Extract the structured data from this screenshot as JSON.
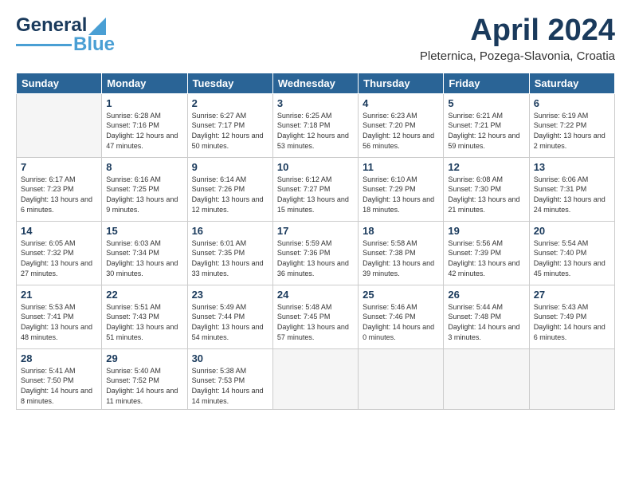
{
  "header": {
    "logo": {
      "line1": "General",
      "line2": "Blue"
    },
    "title": "April 2024",
    "location": "Pleternica, Pozega-Slavonia, Croatia"
  },
  "calendar": {
    "days_of_week": [
      "Sunday",
      "Monday",
      "Tuesday",
      "Wednesday",
      "Thursday",
      "Friday",
      "Saturday"
    ],
    "weeks": [
      [
        {
          "day": "",
          "sunrise": "",
          "sunset": "",
          "daylight": ""
        },
        {
          "day": "1",
          "sunrise": "Sunrise: 6:28 AM",
          "sunset": "Sunset: 7:16 PM",
          "daylight": "Daylight: 12 hours and 47 minutes."
        },
        {
          "day": "2",
          "sunrise": "Sunrise: 6:27 AM",
          "sunset": "Sunset: 7:17 PM",
          "daylight": "Daylight: 12 hours and 50 minutes."
        },
        {
          "day": "3",
          "sunrise": "Sunrise: 6:25 AM",
          "sunset": "Sunset: 7:18 PM",
          "daylight": "Daylight: 12 hours and 53 minutes."
        },
        {
          "day": "4",
          "sunrise": "Sunrise: 6:23 AM",
          "sunset": "Sunset: 7:20 PM",
          "daylight": "Daylight: 12 hours and 56 minutes."
        },
        {
          "day": "5",
          "sunrise": "Sunrise: 6:21 AM",
          "sunset": "Sunset: 7:21 PM",
          "daylight": "Daylight: 12 hours and 59 minutes."
        },
        {
          "day": "6",
          "sunrise": "Sunrise: 6:19 AM",
          "sunset": "Sunset: 7:22 PM",
          "daylight": "Daylight: 13 hours and 2 minutes."
        }
      ],
      [
        {
          "day": "7",
          "sunrise": "Sunrise: 6:17 AM",
          "sunset": "Sunset: 7:23 PM",
          "daylight": "Daylight: 13 hours and 6 minutes."
        },
        {
          "day": "8",
          "sunrise": "Sunrise: 6:16 AM",
          "sunset": "Sunset: 7:25 PM",
          "daylight": "Daylight: 13 hours and 9 minutes."
        },
        {
          "day": "9",
          "sunrise": "Sunrise: 6:14 AM",
          "sunset": "Sunset: 7:26 PM",
          "daylight": "Daylight: 13 hours and 12 minutes."
        },
        {
          "day": "10",
          "sunrise": "Sunrise: 6:12 AM",
          "sunset": "Sunset: 7:27 PM",
          "daylight": "Daylight: 13 hours and 15 minutes."
        },
        {
          "day": "11",
          "sunrise": "Sunrise: 6:10 AM",
          "sunset": "Sunset: 7:29 PM",
          "daylight": "Daylight: 13 hours and 18 minutes."
        },
        {
          "day": "12",
          "sunrise": "Sunrise: 6:08 AM",
          "sunset": "Sunset: 7:30 PM",
          "daylight": "Daylight: 13 hours and 21 minutes."
        },
        {
          "day": "13",
          "sunrise": "Sunrise: 6:06 AM",
          "sunset": "Sunset: 7:31 PM",
          "daylight": "Daylight: 13 hours and 24 minutes."
        }
      ],
      [
        {
          "day": "14",
          "sunrise": "Sunrise: 6:05 AM",
          "sunset": "Sunset: 7:32 PM",
          "daylight": "Daylight: 13 hours and 27 minutes."
        },
        {
          "day": "15",
          "sunrise": "Sunrise: 6:03 AM",
          "sunset": "Sunset: 7:34 PM",
          "daylight": "Daylight: 13 hours and 30 minutes."
        },
        {
          "day": "16",
          "sunrise": "Sunrise: 6:01 AM",
          "sunset": "Sunset: 7:35 PM",
          "daylight": "Daylight: 13 hours and 33 minutes."
        },
        {
          "day": "17",
          "sunrise": "Sunrise: 5:59 AM",
          "sunset": "Sunset: 7:36 PM",
          "daylight": "Daylight: 13 hours and 36 minutes."
        },
        {
          "day": "18",
          "sunrise": "Sunrise: 5:58 AM",
          "sunset": "Sunset: 7:38 PM",
          "daylight": "Daylight: 13 hours and 39 minutes."
        },
        {
          "day": "19",
          "sunrise": "Sunrise: 5:56 AM",
          "sunset": "Sunset: 7:39 PM",
          "daylight": "Daylight: 13 hours and 42 minutes."
        },
        {
          "day": "20",
          "sunrise": "Sunrise: 5:54 AM",
          "sunset": "Sunset: 7:40 PM",
          "daylight": "Daylight: 13 hours and 45 minutes."
        }
      ],
      [
        {
          "day": "21",
          "sunrise": "Sunrise: 5:53 AM",
          "sunset": "Sunset: 7:41 PM",
          "daylight": "Daylight: 13 hours and 48 minutes."
        },
        {
          "day": "22",
          "sunrise": "Sunrise: 5:51 AM",
          "sunset": "Sunset: 7:43 PM",
          "daylight": "Daylight: 13 hours and 51 minutes."
        },
        {
          "day": "23",
          "sunrise": "Sunrise: 5:49 AM",
          "sunset": "Sunset: 7:44 PM",
          "daylight": "Daylight: 13 hours and 54 minutes."
        },
        {
          "day": "24",
          "sunrise": "Sunrise: 5:48 AM",
          "sunset": "Sunset: 7:45 PM",
          "daylight": "Daylight: 13 hours and 57 minutes."
        },
        {
          "day": "25",
          "sunrise": "Sunrise: 5:46 AM",
          "sunset": "Sunset: 7:46 PM",
          "daylight": "Daylight: 14 hours and 0 minutes."
        },
        {
          "day": "26",
          "sunrise": "Sunrise: 5:44 AM",
          "sunset": "Sunset: 7:48 PM",
          "daylight": "Daylight: 14 hours and 3 minutes."
        },
        {
          "day": "27",
          "sunrise": "Sunrise: 5:43 AM",
          "sunset": "Sunset: 7:49 PM",
          "daylight": "Daylight: 14 hours and 6 minutes."
        }
      ],
      [
        {
          "day": "28",
          "sunrise": "Sunrise: 5:41 AM",
          "sunset": "Sunset: 7:50 PM",
          "daylight": "Daylight: 14 hours and 8 minutes."
        },
        {
          "day": "29",
          "sunrise": "Sunrise: 5:40 AM",
          "sunset": "Sunset: 7:52 PM",
          "daylight": "Daylight: 14 hours and 11 minutes."
        },
        {
          "day": "30",
          "sunrise": "Sunrise: 5:38 AM",
          "sunset": "Sunset: 7:53 PM",
          "daylight": "Daylight: 14 hours and 14 minutes."
        },
        {
          "day": "",
          "sunrise": "",
          "sunset": "",
          "daylight": ""
        },
        {
          "day": "",
          "sunrise": "",
          "sunset": "",
          "daylight": ""
        },
        {
          "day": "",
          "sunrise": "",
          "sunset": "",
          "daylight": ""
        },
        {
          "day": "",
          "sunrise": "",
          "sunset": "",
          "daylight": ""
        }
      ]
    ]
  }
}
